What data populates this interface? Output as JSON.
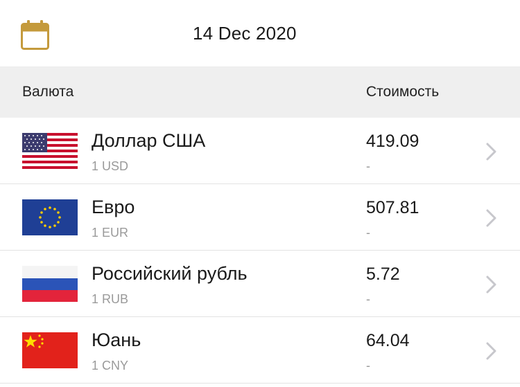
{
  "date_bar": {
    "date": "14 Dec 2020",
    "icon": "calendar-icon",
    "accent": "#c49a3c"
  },
  "header": {
    "currency_label": "Валюта",
    "value_label": "Стоимость"
  },
  "rows": [
    {
      "name": "Доллар США",
      "code": "1 USD",
      "price": "419.09",
      "change": "-",
      "flag": "us-flag-icon"
    },
    {
      "name": "Евро",
      "code": "1 EUR",
      "price": "507.81",
      "change": "-",
      "flag": "eu-flag-icon"
    },
    {
      "name": "Российский рубль",
      "code": "1 RUB",
      "price": "5.72",
      "change": "-",
      "flag": "ru-flag-icon"
    },
    {
      "name": "Юань",
      "code": "1 CNY",
      "price": "64.04",
      "change": "-",
      "flag": "cn-flag-icon"
    }
  ]
}
